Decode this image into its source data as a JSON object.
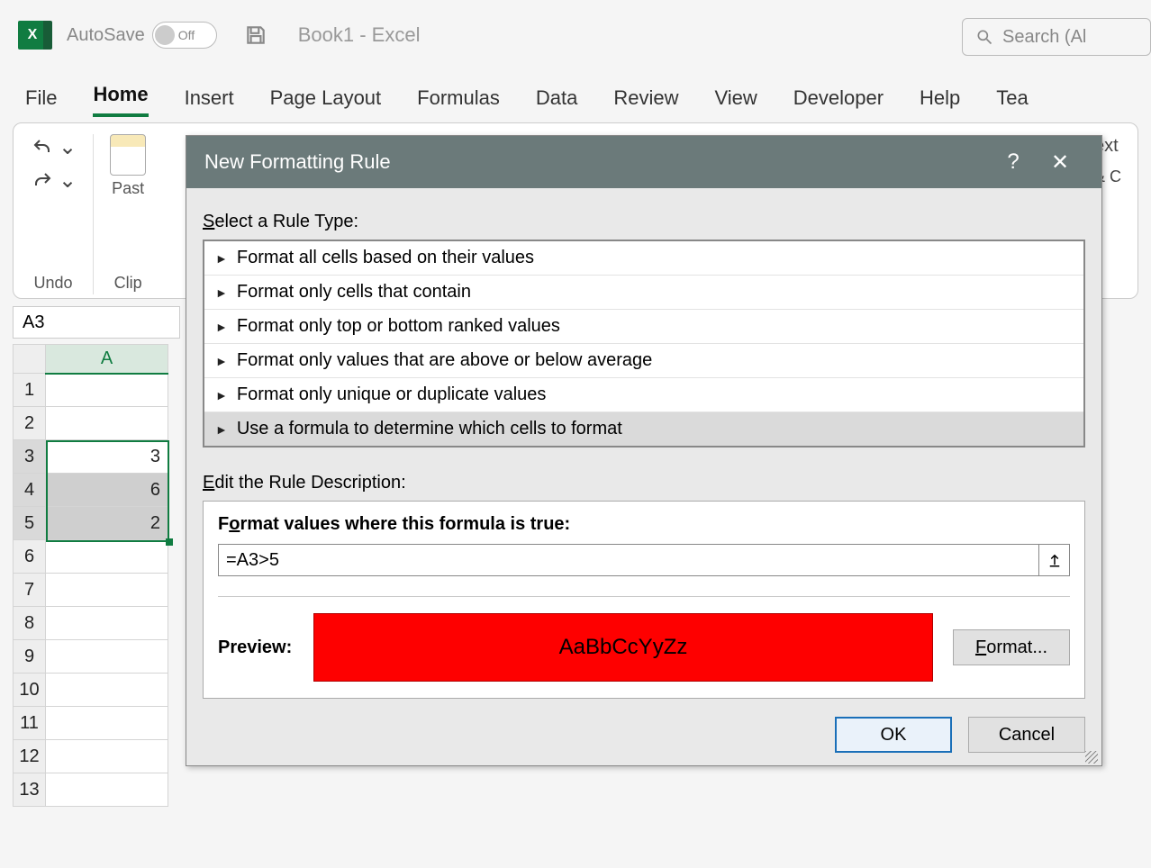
{
  "titlebar": {
    "autosave_label": "AutoSave",
    "autosave_state": "Off",
    "doc_title": "Book1  -  Excel",
    "search_placeholder": "Search (Al"
  },
  "tabs": [
    "File",
    "Home",
    "Insert",
    "Page Layout",
    "Formulas",
    "Data",
    "Review",
    "View",
    "Developer",
    "Help",
    "Tea"
  ],
  "active_tab": "Home",
  "ribbon": {
    "undo_group": "Undo",
    "clipboard_group": "Clip",
    "paste_label": "Past",
    "right1": "ext",
    "right2": "& C"
  },
  "namebox": "A3",
  "grid": {
    "col": "A",
    "rows": [
      {
        "n": "1",
        "v": ""
      },
      {
        "n": "2",
        "v": ""
      },
      {
        "n": "3",
        "v": "3"
      },
      {
        "n": "4",
        "v": "6"
      },
      {
        "n": "5",
        "v": "2"
      },
      {
        "n": "6",
        "v": ""
      },
      {
        "n": "7",
        "v": ""
      },
      {
        "n": "8",
        "v": ""
      },
      {
        "n": "9",
        "v": ""
      },
      {
        "n": "10",
        "v": ""
      },
      {
        "n": "11",
        "v": ""
      },
      {
        "n": "12",
        "v": ""
      },
      {
        "n": "13",
        "v": ""
      }
    ]
  },
  "dialog": {
    "title": "New Formatting Rule",
    "select_label_pre": "S",
    "select_label_rest": "elect a Rule Type:",
    "rule_types": [
      "Format all cells based on their values",
      "Format only cells that contain",
      "Format only top or bottom ranked values",
      "Format only values that are above or below average",
      "Format only unique or duplicate values",
      "Use a formula to determine which cells to format"
    ],
    "selected_rule_index": 5,
    "edit_label_pre": "E",
    "edit_label_rest": "dit the Rule Description:",
    "formula_label": "Format values where this formula is true:",
    "formula_label_ul": "o",
    "formula_value": "=A3>5",
    "preview_label": "Preview:",
    "preview_text": "AaBbCcYyZz",
    "preview_bg": "#fe0000",
    "format_btn_pre": "F",
    "format_btn_rest": "ormat...",
    "ok": "OK",
    "cancel": "Cancel"
  }
}
